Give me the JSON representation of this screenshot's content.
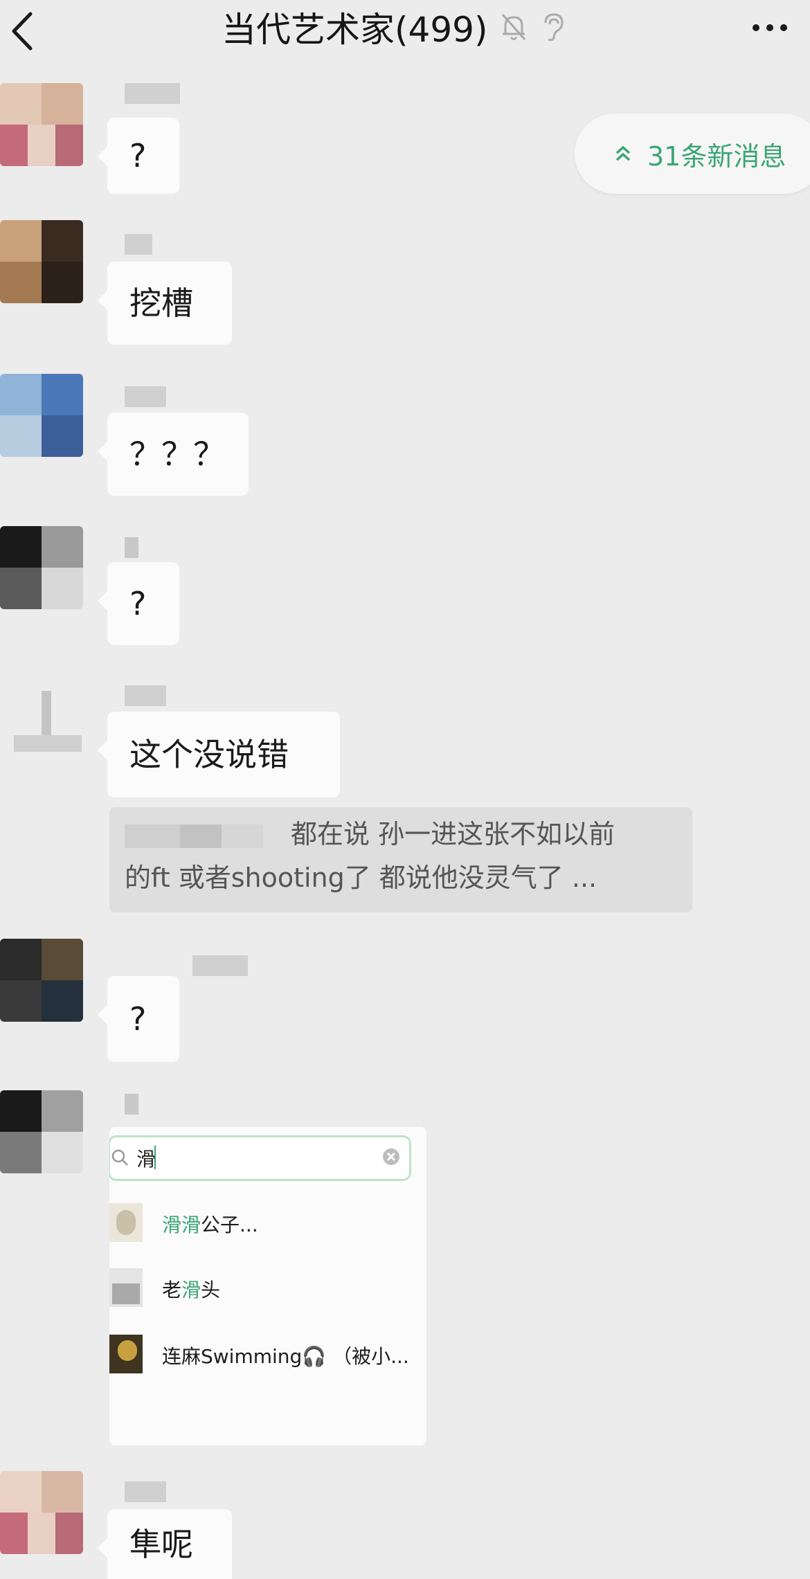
{
  "header": {
    "title": "当代艺术家(499)",
    "back_icon": "chevron-left-icon",
    "mute_icon": "bell-off-icon",
    "ear_icon": "ear-icon",
    "more_icon": "more-dots-icon"
  },
  "new_messages": {
    "label": "31条新消息",
    "icon": "double-chevron-up-icon",
    "color": "#3aa475"
  },
  "messages": [
    {
      "text": "?"
    },
    {
      "text": "挖槽"
    },
    {
      "text": "？？？"
    },
    {
      "text": "?"
    },
    {
      "text": "这个没说错",
      "quote": {
        "line1": "都在说 孙一进这张不如以前",
        "line2": "的ft 或者shooting了 都说他没灵气了 ..."
      }
    },
    {
      "text": "?"
    },
    {
      "image": {
        "search_query": "滑",
        "results": [
          {
            "highlight": "滑滑",
            "rest": "公子..."
          },
          {
            "prefix": "老",
            "highlight": "滑",
            "rest": "头"
          },
          {
            "prefix": "连麻Swimming🎧 （被小..."
          }
        ]
      }
    },
    {
      "text": "隼呢"
    }
  ]
}
